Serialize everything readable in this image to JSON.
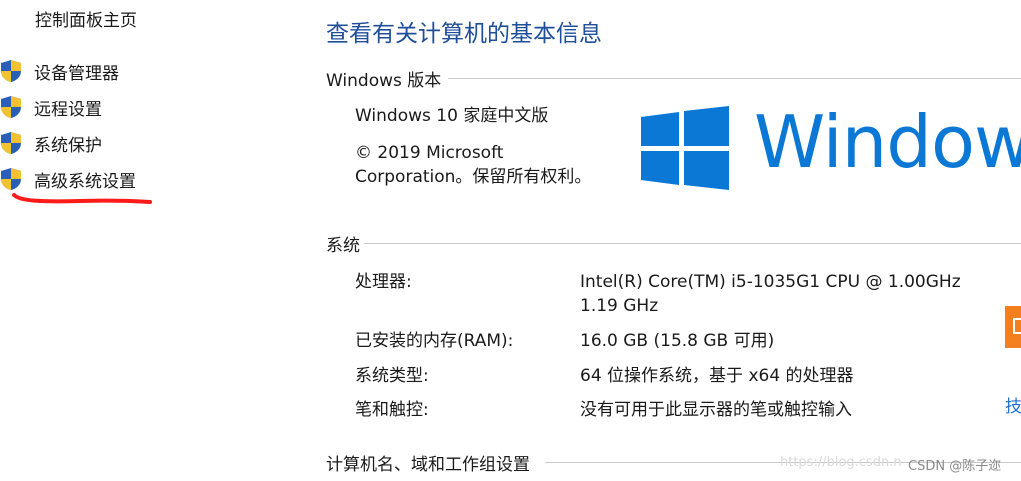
{
  "sidebar": {
    "home": "控制面板主页",
    "items": [
      {
        "label": "设备管理器",
        "icon": "shield-icon"
      },
      {
        "label": "远程设置",
        "icon": "shield-icon"
      },
      {
        "label": "系统保护",
        "icon": "shield-icon"
      },
      {
        "label": "高级系统设置",
        "icon": "shield-icon"
      }
    ],
    "annotation_color": "#ff1a1a"
  },
  "main": {
    "title": "查看有关计算机的基本信息",
    "windows_edition": {
      "heading": "Windows 版本",
      "edition": "Windows 10 家庭中文版",
      "copyright_line1": "© 2019 Microsoft",
      "copyright_line2": "Corporation。保留所有权利。",
      "logo_text": "Windows",
      "logo_color": "#0a78d4"
    },
    "system": {
      "heading": "系统",
      "rows": [
        {
          "label": "处理器:",
          "value": "Intel(R) Core(TM) i5-1035G1 CPU @ 1.00GHz",
          "value2": "1.19 GHz"
        },
        {
          "label": "已安装的内存(RAM):",
          "value": "16.0 GB (15.8 GB 可用)"
        },
        {
          "label": "系统类型:",
          "value": "64 位操作系统，基于 x64 的处理器"
        },
        {
          "label": "笔和触控:",
          "value": "没有可用于此显示器的笔或触控输入"
        }
      ]
    },
    "computer_name_heading": "计算机名、域和工作组设置",
    "right_edge_link": "技"
  },
  "watermark": {
    "url": "https://blog.csdn.n",
    "text": "CSDN @陈子迩"
  }
}
